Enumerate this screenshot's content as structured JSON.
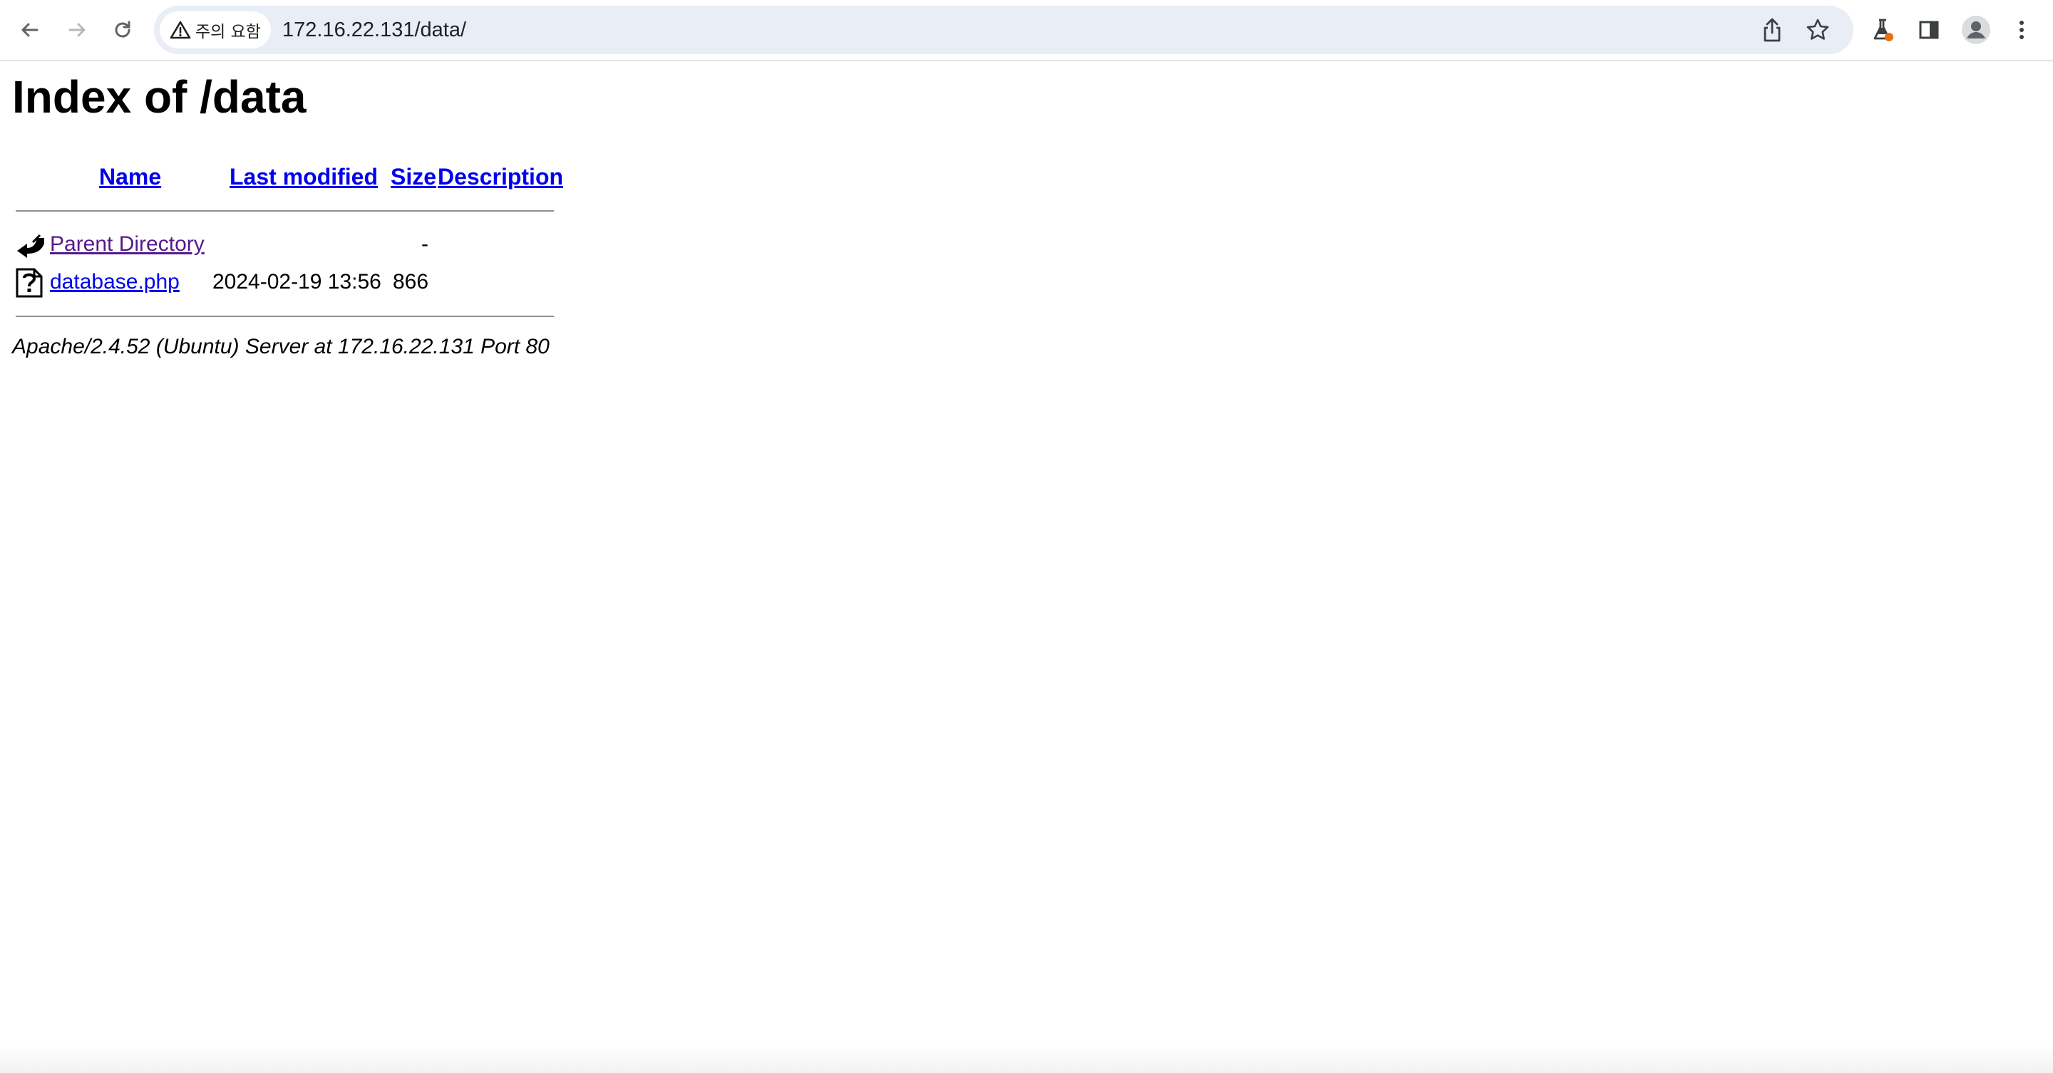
{
  "browser": {
    "security_chip": "주의 요함",
    "url": "172.16.22.131/data/",
    "icons": {
      "back": "arrow-left-icon",
      "forward": "arrow-right-icon",
      "reload": "reload-icon",
      "warning": "warning-triangle-icon",
      "share": "share-icon",
      "bookmark": "star-icon",
      "labs": "flask-icon",
      "side_panel": "side-panel-icon",
      "profile": "profile-avatar-icon",
      "menu": "kebab-menu-icon"
    },
    "colors": {
      "chrome_bg": "#ffffff",
      "omnibox_bg": "#e9edf5",
      "labs_badge": "#e8710a"
    }
  },
  "page": {
    "title": "Index of /data",
    "columns": [
      "Name",
      "Last modified",
      "Size",
      "Description"
    ],
    "rows": [
      {
        "icon": "back-arrow-icon",
        "name": "Parent Directory",
        "last_modified": "",
        "size": "-",
        "description": "",
        "visited": true
      },
      {
        "icon": "unknown-file-icon",
        "name": "database.php",
        "last_modified": "2024-02-19 13:56",
        "size": "866",
        "description": "",
        "visited": false
      }
    ],
    "address": "Apache/2.4.52 (Ubuntu) Server at 172.16.22.131 Port 80",
    "colors": {
      "link": "#0000ee",
      "visited_link": "#551a8b"
    }
  }
}
